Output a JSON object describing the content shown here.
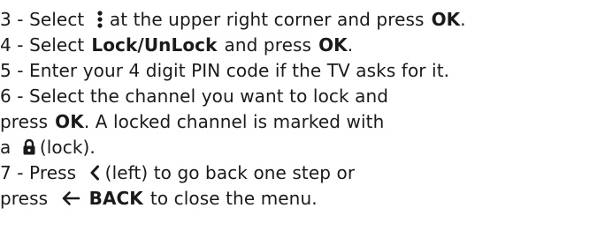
{
  "instructions": {
    "step3": {
      "prefix": "3 - ",
      "select": "Select",
      "text_after_icon": "at the upper right corner and press",
      "ok": "OK",
      "period": "."
    },
    "step4": {
      "prefix": "4 - ",
      "select": "Select",
      "option": "Lock/UnLock",
      "and_press": "and press",
      "ok": "OK",
      "period": "."
    },
    "step5": {
      "text": "5 - Enter your 4 digit PIN code if the TV asks for it."
    },
    "step6": {
      "line1": "6 - Select the channel you want to lock and",
      "press": "press",
      "ok": "OK",
      "rest": ". A locked channel is marked with",
      "a": "a",
      "lock_label": "(lock)."
    },
    "step7": {
      "prefix": "7 - Press",
      "left_label": "(left) to go back one step or",
      "press": "press",
      "back": "BACK",
      "rest": "to close the menu."
    }
  },
  "icons": {
    "menu": "more-vertical-icon",
    "lock": "lock-icon",
    "left": "chevron-left-icon",
    "back": "arrow-left-icon"
  }
}
